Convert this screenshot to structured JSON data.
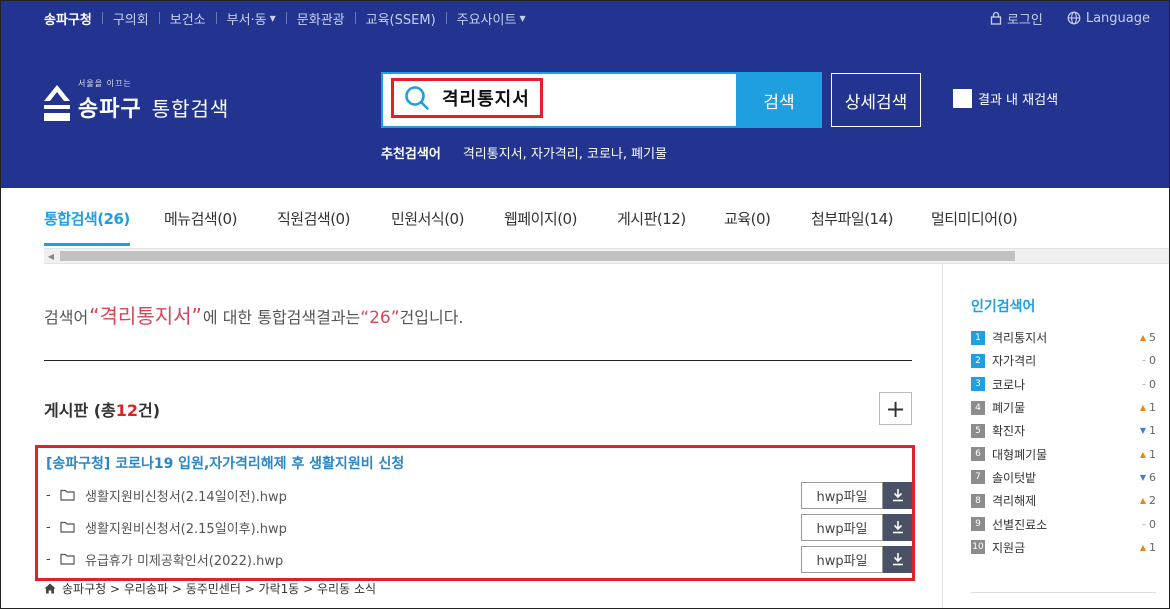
{
  "topnav": {
    "items": [
      {
        "label": "송파구청",
        "active": true
      },
      {
        "label": "구의회"
      },
      {
        "label": "보건소"
      },
      {
        "label": "부서·동",
        "caret": true
      },
      {
        "label": "문화관광"
      },
      {
        "label": "교육(SSEM)"
      },
      {
        "label": "주요사이트",
        "caret": true
      }
    ],
    "login_label": "로그인",
    "language_label": "Language"
  },
  "header": {
    "logo_small": "서울을 이끄는",
    "logo_gu": "송파구",
    "logo_title": "통합검색",
    "search_value": "격리통지서",
    "search_button": "검색",
    "advanced_button": "상세검색",
    "research_label": "결과 내 재검색",
    "recommend_label": "추천검색어",
    "recommend_terms": "격리통지서, 자가격리, 코로나, 폐기물"
  },
  "tabs": [
    {
      "label": "통합검색(26)",
      "active": true
    },
    {
      "label": "메뉴검색(0)"
    },
    {
      "label": "직원검색(0)"
    },
    {
      "label": "민원서식(0)"
    },
    {
      "label": "웹페이지(0)"
    },
    {
      "label": "게시판(12)"
    },
    {
      "label": "교육(0)"
    },
    {
      "label": "첨부파일(14)"
    },
    {
      "label": "멀티미디어(0)"
    }
  ],
  "summary": {
    "prefix": "검색어 ",
    "query": "“격리통지서”",
    "middle": "에 대한 통합검색결과는 ",
    "count": "“26”",
    "suffix": "건입니다."
  },
  "section": {
    "title_prefix": "게시판 (총",
    "count": "12",
    "title_suffix": "건)",
    "plus": "+"
  },
  "result": {
    "title": "[송파구청] 코로나19 입원,자가격리해제 후 생활지원비 신청",
    "files": [
      {
        "dash": "-",
        "name": "생활지원비신청서(2.14일이전).hwp",
        "button": "hwp파일"
      },
      {
        "dash": "-",
        "name": "생활지원비신청서(2.15일이후).hwp",
        "button": "hwp파일"
      },
      {
        "dash": "-",
        "name": "유급휴가 미제공확인서(2022).hwp",
        "button": "hwp파일"
      }
    ]
  },
  "breadcrumb": "송파구청 > 우리송파 > 동주민센터 > 가락1동 > 우리동 소식",
  "popular": {
    "title": "인기검색어",
    "items": [
      {
        "rank": "1",
        "keyword": "격리통지서",
        "trend": "up",
        "change": "5"
      },
      {
        "rank": "2",
        "keyword": "자가격리",
        "trend": "same",
        "change": "0"
      },
      {
        "rank": "3",
        "keyword": "코로나",
        "trend": "same",
        "change": "0"
      },
      {
        "rank": "4",
        "keyword": "폐기물",
        "trend": "up",
        "change": "1"
      },
      {
        "rank": "5",
        "keyword": "확진자",
        "trend": "down",
        "change": "1"
      },
      {
        "rank": "6",
        "keyword": "대형폐기물",
        "trend": "up",
        "change": "1"
      },
      {
        "rank": "7",
        "keyword": "솔이텃밭",
        "trend": "down",
        "change": "6"
      },
      {
        "rank": "8",
        "keyword": "격리해제",
        "trend": "up",
        "change": "2"
      },
      {
        "rank": "9",
        "keyword": "선별진료소",
        "trend": "same",
        "change": "0"
      },
      {
        "rank": "10",
        "keyword": "지원금",
        "trend": "up",
        "change": "1"
      }
    ]
  },
  "colors": {
    "header_bg": "#22348f",
    "accent": "#1f9ee0",
    "highlight_red": "#e12127",
    "query_red": "#d6465b",
    "result_title_blue": "#2b86c5"
  }
}
